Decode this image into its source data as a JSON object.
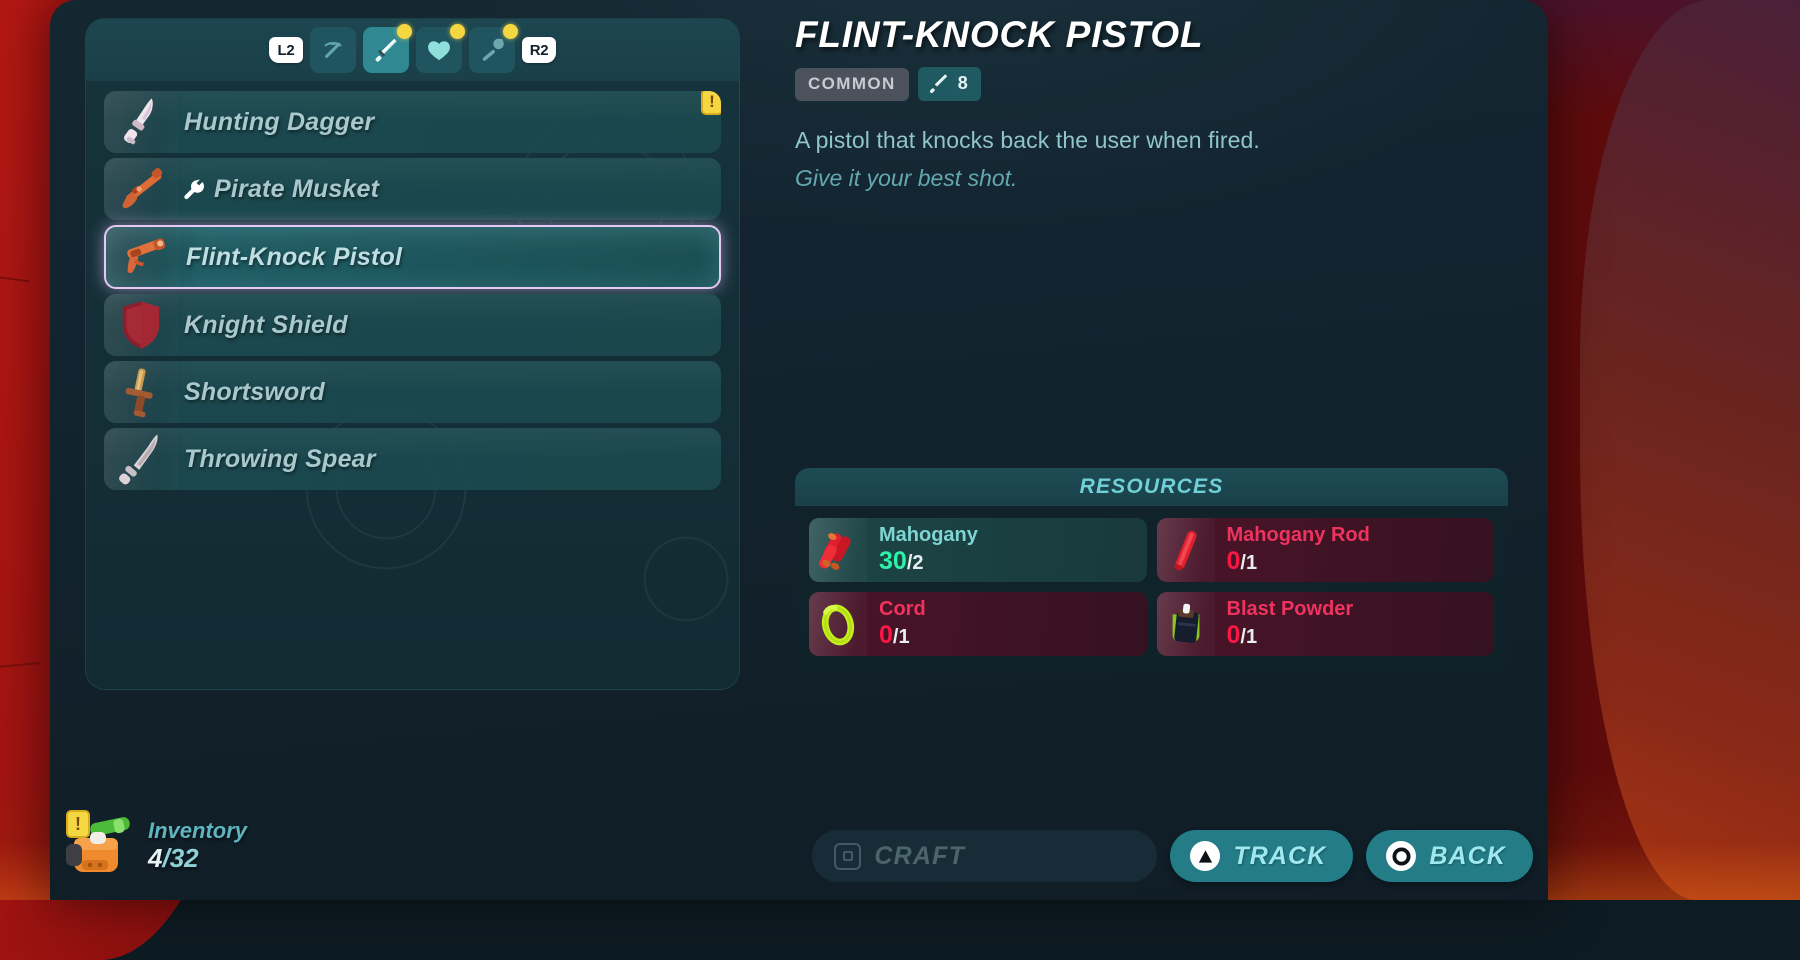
{
  "tabbar": {
    "left_bumper": "L2",
    "right_bumper": "R2",
    "tabs": [
      {
        "id": "tools",
        "icon": "pickaxe-icon",
        "active": false,
        "has_new": false
      },
      {
        "id": "weapons",
        "icon": "sword-icon",
        "active": true,
        "has_new": true
      },
      {
        "id": "healing",
        "icon": "heart-icon",
        "active": false,
        "has_new": true
      },
      {
        "id": "utility",
        "icon": "torch-icon",
        "active": false,
        "has_new": true
      }
    ]
  },
  "items": [
    {
      "name": "Hunting Dagger",
      "icon": "dagger-icon",
      "selected": false,
      "badge": "!",
      "has_wrench": false
    },
    {
      "name": "Pirate Musket",
      "icon": "musket-icon",
      "selected": false,
      "badge": null,
      "has_wrench": true
    },
    {
      "name": "Flint-Knock Pistol",
      "icon": "pistol-icon",
      "selected": true,
      "badge": null,
      "has_wrench": false
    },
    {
      "name": "Knight Shield",
      "icon": "shield-icon",
      "selected": false,
      "badge": null,
      "has_wrench": false
    },
    {
      "name": "Shortsword",
      "icon": "sword-item-icon",
      "selected": false,
      "badge": null,
      "has_wrench": false
    },
    {
      "name": "Throwing Spear",
      "icon": "spear-icon",
      "selected": false,
      "badge": null,
      "has_wrench": false
    }
  ],
  "detail": {
    "title": "FLINT-KNOCK PISTOL",
    "rarity": "COMMON",
    "damage_icon": "sword-icon",
    "damage_value": "8",
    "description": "A pistol that knocks back the user when fired.",
    "flavor": "Give it your best shot."
  },
  "resources": {
    "header": "RESOURCES",
    "items": [
      {
        "name": "Mahogany",
        "icon": "wood-logs-icon",
        "current": "30",
        "required": "/2",
        "status": "have"
      },
      {
        "name": "Mahogany Rod",
        "icon": "wood-rod-icon",
        "current": "0",
        "required": "/1",
        "status": "missing"
      },
      {
        "name": "Cord",
        "icon": "cord-icon",
        "current": "0",
        "required": "/1",
        "status": "missing"
      },
      {
        "name": "Blast Powder",
        "icon": "powder-keg-icon",
        "current": "0",
        "required": "/1",
        "status": "missing"
      }
    ]
  },
  "inventory": {
    "icon": "backpack-icon",
    "badge": "!",
    "label": "Inventory",
    "current": "4",
    "capacity": "/32"
  },
  "actions": {
    "craft": {
      "label": "CRAFT",
      "button_glyph": "square-button-icon",
      "enabled": false
    },
    "track": {
      "label": "TRACK",
      "button_glyph": "triangle-button-icon",
      "enabled": true
    },
    "back": {
      "label": "BACK",
      "button_glyph": "circle-button-icon",
      "enabled": true
    }
  },
  "colors": {
    "accent_teal": "#2f8892",
    "panel_bg": "#142630",
    "selected_border": "#e6c8f5",
    "resource_have": "#2ff0a8",
    "resource_missing": "#fb1744",
    "badge_yellow": "#f5d742"
  }
}
